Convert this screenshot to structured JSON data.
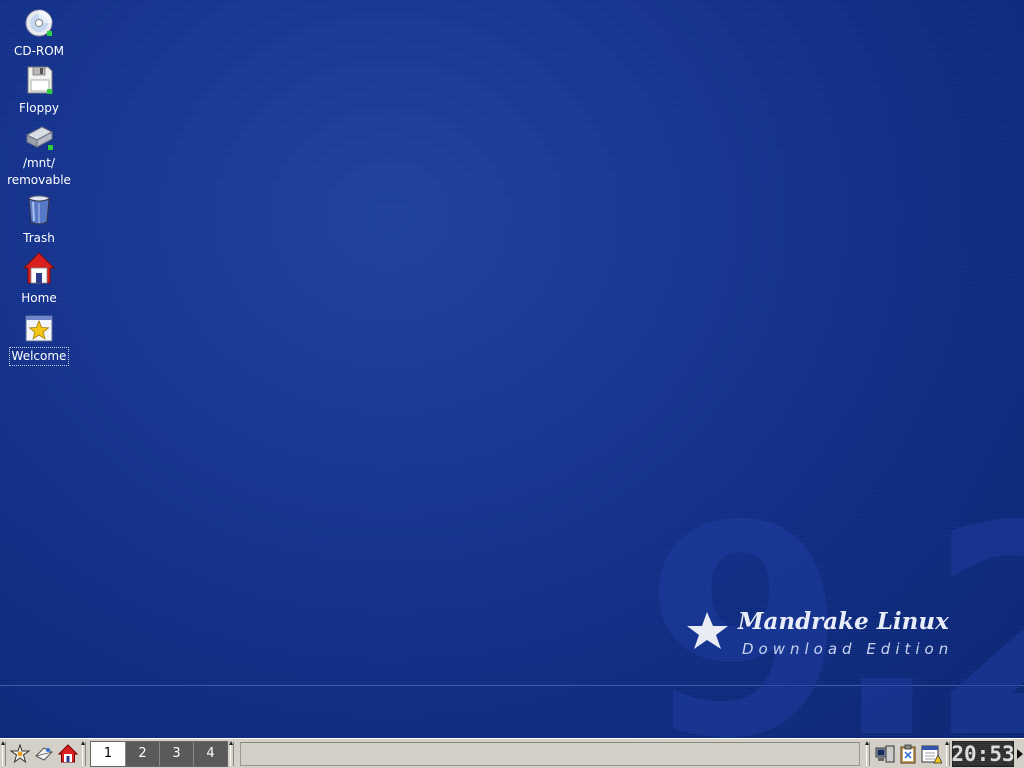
{
  "desktop": {
    "icons": [
      {
        "label": "CD-ROM",
        "icon": "cdrom-icon"
      },
      {
        "label": "Floppy",
        "icon": "floppy-icon"
      },
      {
        "label": "/mnt/\nremovable",
        "line1": "/mnt/",
        "line2": "removable",
        "icon": "removable-drive-icon"
      },
      {
        "label": "Trash",
        "icon": "trash-icon"
      },
      {
        "label": "Home",
        "icon": "home-icon"
      },
      {
        "label": "Welcome",
        "icon": "welcome-star-icon",
        "selected": true
      }
    ]
  },
  "branding": {
    "version": "9.2",
    "name": "Mandrake Linux",
    "edition": "Download Edition"
  },
  "taskbar": {
    "launchers": [
      "kmenu-star-icon",
      "mail-icon",
      "home-icon"
    ],
    "pager": [
      "1",
      "2",
      "3",
      "4"
    ],
    "active_desktop": "1",
    "tray_icons": [
      "network-monitor-icon",
      "klipper-icon",
      "calendar-icon"
    ],
    "clock": "20:53"
  },
  "colors": {
    "desktop_bg": "#163592",
    "taskbar_bg": "#d4d0c8"
  }
}
